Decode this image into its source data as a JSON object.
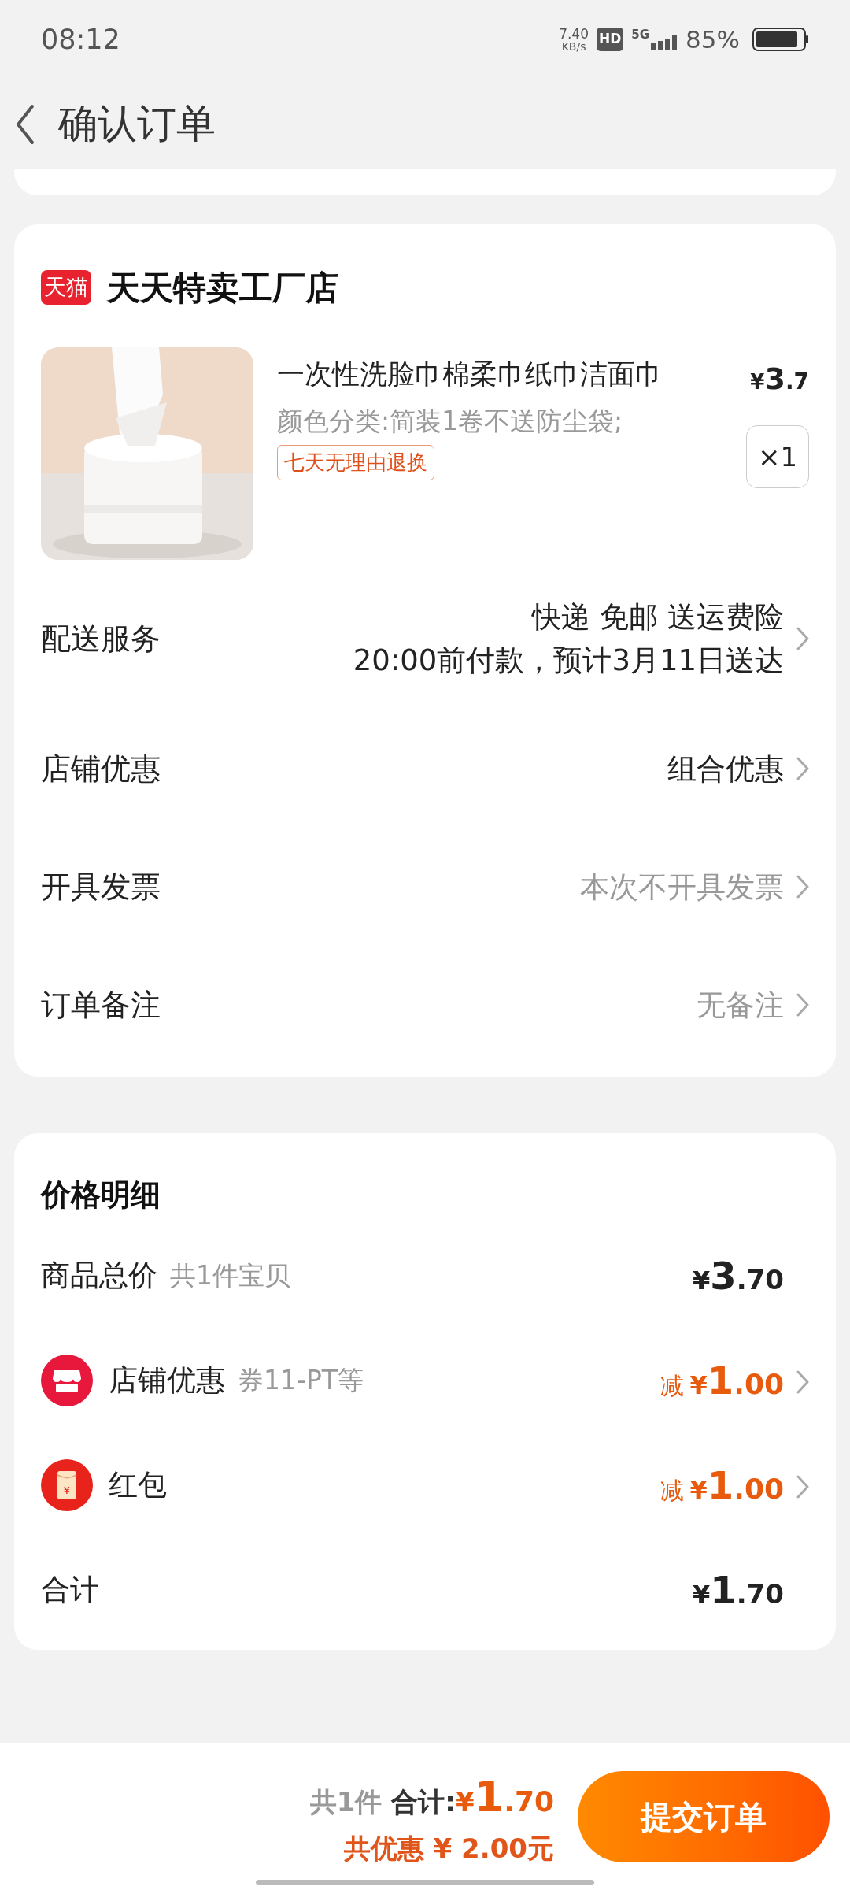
{
  "status_bar": {
    "time": "08:12",
    "net_speed": "7.40",
    "net_unit": "KB/s",
    "hd": "HD",
    "network": "5G",
    "battery": "85%"
  },
  "header": {
    "title": "确认订单"
  },
  "shop": {
    "logo": "天猫",
    "name": "天天特卖工厂店",
    "product": {
      "kind": "picture",
      "title": "一次性洗脸巾棉柔巾纸巾洁面巾",
      "spec": "颜色分类:简装1卷不送防尘袋;",
      "tag": "七天无理由退换",
      "price": {
        "symbol": "¥",
        "integer": "3",
        "decimal": ".7"
      },
      "quantity": "×1"
    },
    "rows": [
      {
        "label": "配送服务",
        "values": [
          "快递 免邮 送运费险",
          "20:00前付款，预计3月11日送达"
        ],
        "muted": false
      },
      {
        "label": "店铺优惠",
        "values": [
          "组合优惠"
        ],
        "muted": false
      },
      {
        "label": "开具发票",
        "values": [
          "本次不开具发票"
        ],
        "muted": true
      },
      {
        "label": "订单备注",
        "values": [
          "无备注"
        ],
        "muted": true
      }
    ]
  },
  "price_detail": {
    "title": "价格明细",
    "rows": [
      {
        "kind": "plain",
        "label": "商品总价",
        "note": "共1件宝贝",
        "amount": {
          "symbol": "¥",
          "integer": "3",
          "decimal": ".70"
        },
        "chevron": false
      },
      {
        "kind": "store",
        "label": "店铺优惠",
        "note": "券11-PT等",
        "prefix": "减",
        "amount": {
          "symbol": "¥",
          "integer": "1",
          "decimal": ".00"
        },
        "chevron": true
      },
      {
        "kind": "packet",
        "badge_text": "¥",
        "label": "红包",
        "prefix": "减",
        "amount": {
          "symbol": "¥",
          "integer": "1",
          "decimal": ".00"
        },
        "chevron": true
      },
      {
        "kind": "plain",
        "label": "合计",
        "amount": {
          "symbol": "¥",
          "integer": "1",
          "decimal": ".70"
        },
        "chevron": false
      }
    ]
  },
  "bottom_bar": {
    "count": "共1件",
    "total_label": "合计:",
    "total": {
      "symbol": "¥",
      "integer": "1",
      "decimal": ".70"
    },
    "saving": "共优惠 ¥ 2.00元",
    "button": "提交订单"
  }
}
